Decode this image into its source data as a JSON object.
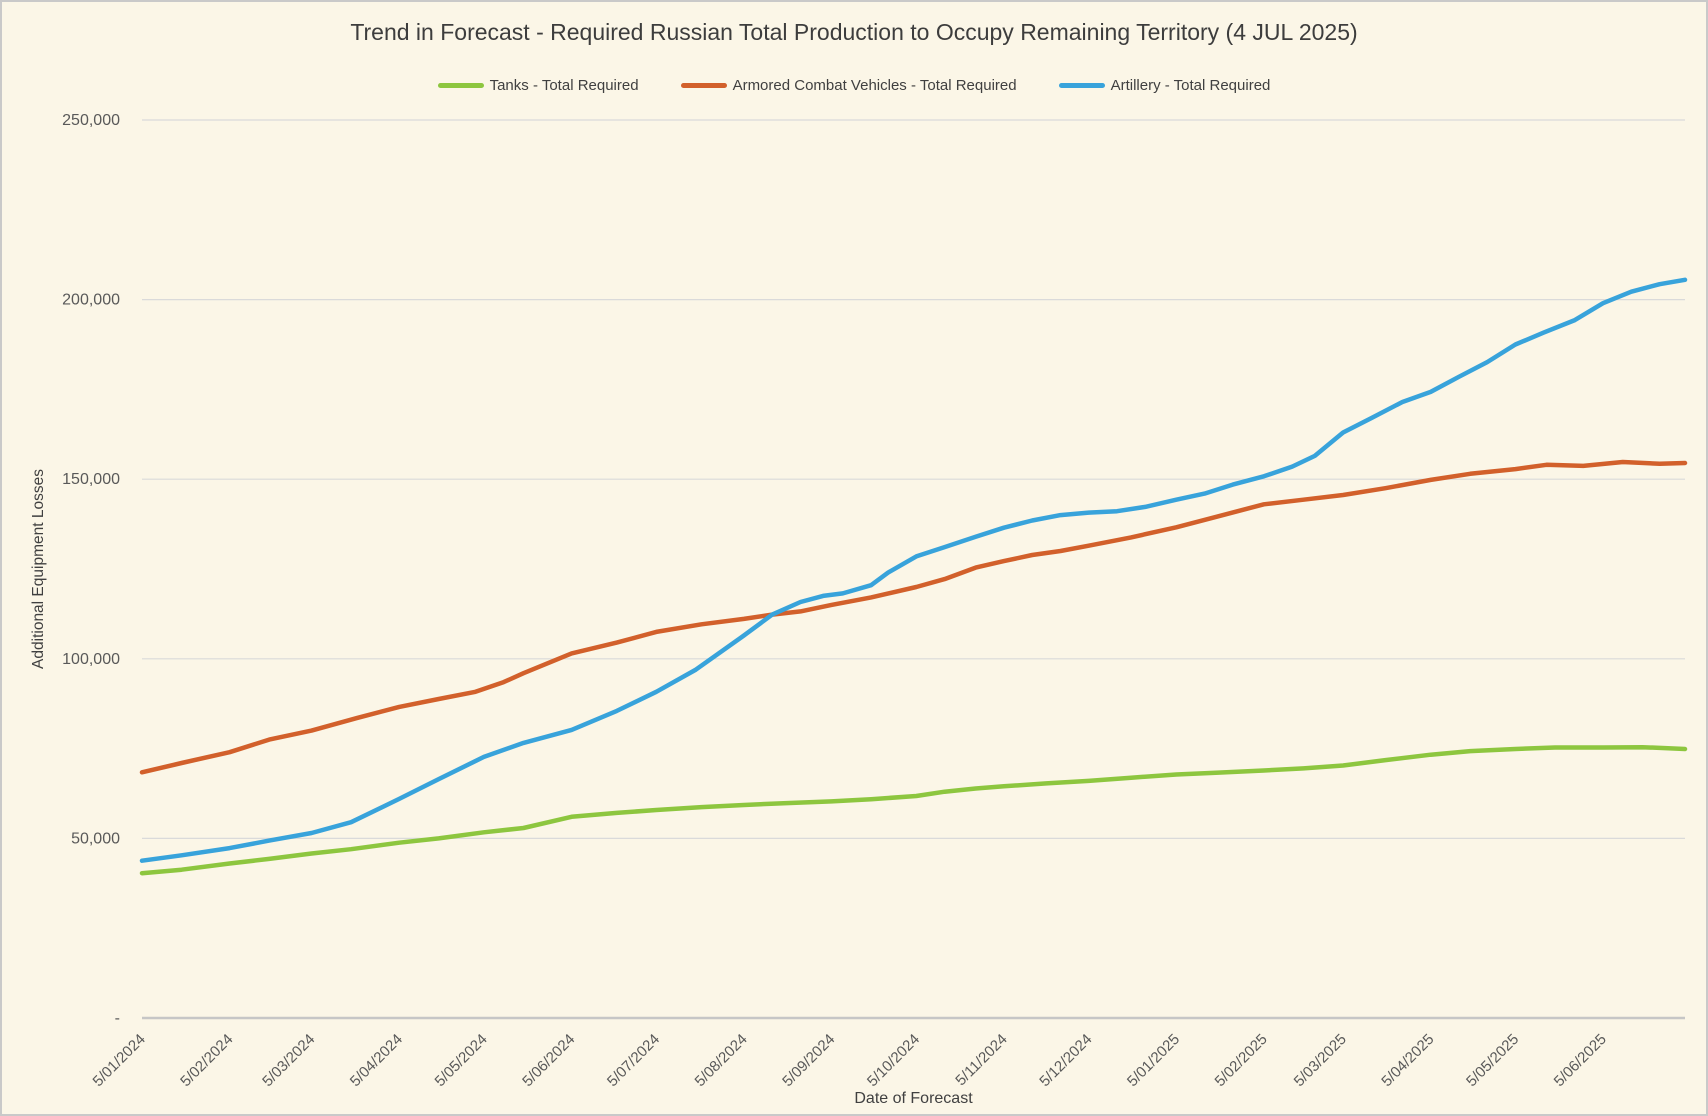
{
  "chart_data": {
    "type": "line",
    "title": "Trend in Forecast - Required Russian Total Production to Occupy Remaining Territory (4 JUL 2025)",
    "xlabel": "Date of Forecast",
    "ylabel": "Additional Equipment Losses",
    "legend_position": "top",
    "grid": "horizontal-only",
    "background_color": "#FBF6E7",
    "grid_color": "#DADADA",
    "axis_line_color": "#C6C6C6",
    "title_color": "#3D3D3D",
    "tick_label_color": "#595959",
    "ylim": [
      0,
      250000
    ],
    "x_axis_note": "weekly forecasts; day 0 = 5/01/2024, day 546 = 4 JUL 2025",
    "y_ticks": [
      {
        "value": 0,
        "label": "-"
      },
      {
        "value": 50000,
        "label": "50,000"
      },
      {
        "value": 100000,
        "label": "100,000"
      },
      {
        "value": 150000,
        "label": "150,000"
      },
      {
        "value": 200000,
        "label": "200,000"
      },
      {
        "value": 250000,
        "label": "250,000"
      }
    ],
    "x_ticks": [
      {
        "day": 0,
        "label": "5/01/2024"
      },
      {
        "day": 31,
        "label": "5/02/2024"
      },
      {
        "day": 60,
        "label": "5/03/2024"
      },
      {
        "day": 91,
        "label": "5/04/2024"
      },
      {
        "day": 121,
        "label": "5/05/2024"
      },
      {
        "day": 152,
        "label": "5/06/2024"
      },
      {
        "day": 182,
        "label": "5/07/2024"
      },
      {
        "day": 213,
        "label": "5/08/2024"
      },
      {
        "day": 244,
        "label": "5/09/2024"
      },
      {
        "day": 274,
        "label": "5/10/2024"
      },
      {
        "day": 305,
        "label": "5/11/2024"
      },
      {
        "day": 335,
        "label": "5/12/2024"
      },
      {
        "day": 366,
        "label": "5/01/2025"
      },
      {
        "day": 397,
        "label": "5/02/2025"
      },
      {
        "day": 425,
        "label": "5/03/2025"
      },
      {
        "day": 456,
        "label": "5/04/2025"
      },
      {
        "day": 486,
        "label": "5/05/2025"
      },
      {
        "day": 517,
        "label": "5/06/2025"
      }
    ],
    "series": [
      {
        "name": "Tanks - Total Required",
        "color": "#8DC63F",
        "points": [
          [
            0,
            40300
          ],
          [
            14,
            41300
          ],
          [
            31,
            43000
          ],
          [
            45,
            44300
          ],
          [
            60,
            45800
          ],
          [
            74,
            47000
          ],
          [
            91,
            48800
          ],
          [
            105,
            50000
          ],
          [
            121,
            51700
          ],
          [
            135,
            52900
          ],
          [
            152,
            56000
          ],
          [
            168,
            57100
          ],
          [
            182,
            57900
          ],
          [
            198,
            58700
          ],
          [
            213,
            59300
          ],
          [
            227,
            59800
          ],
          [
            244,
            60300
          ],
          [
            258,
            60900
          ],
          [
            274,
            61800
          ],
          [
            284,
            63000
          ],
          [
            295,
            63900
          ],
          [
            305,
            64500
          ],
          [
            320,
            65300
          ],
          [
            335,
            66000
          ],
          [
            350,
            66900
          ],
          [
            366,
            67800
          ],
          [
            380,
            68300
          ],
          [
            397,
            68900
          ],
          [
            411,
            69500
          ],
          [
            425,
            70300
          ],
          [
            440,
            71800
          ],
          [
            456,
            73300
          ],
          [
            470,
            74300
          ],
          [
            486,
            74900
          ],
          [
            500,
            75300
          ],
          [
            517,
            75300
          ],
          [
            531,
            75400
          ],
          [
            546,
            74900
          ]
        ]
      },
      {
        "name": "Armored Combat Vehicles - Total Required",
        "color": "#D2602B",
        "points": [
          [
            0,
            68400
          ],
          [
            14,
            71000
          ],
          [
            31,
            74000
          ],
          [
            45,
            77500
          ],
          [
            60,
            80000
          ],
          [
            76,
            83500
          ],
          [
            91,
            86600
          ],
          [
            105,
            88800
          ],
          [
            118,
            90800
          ],
          [
            128,
            93500
          ],
          [
            135,
            96000
          ],
          [
            152,
            101500
          ],
          [
            168,
            104500
          ],
          [
            182,
            107500
          ],
          [
            198,
            109600
          ],
          [
            213,
            111100
          ],
          [
            223,
            112300
          ],
          [
            233,
            113200
          ],
          [
            244,
            115000
          ],
          [
            258,
            117100
          ],
          [
            274,
            120000
          ],
          [
            284,
            122200
          ],
          [
            295,
            125400
          ],
          [
            305,
            127200
          ],
          [
            315,
            128900
          ],
          [
            325,
            130000
          ],
          [
            335,
            131500
          ],
          [
            350,
            133800
          ],
          [
            366,
            136600
          ],
          [
            380,
            139500
          ],
          [
            397,
            143000
          ],
          [
            411,
            144300
          ],
          [
            425,
            145600
          ],
          [
            440,
            147500
          ],
          [
            456,
            149800
          ],
          [
            470,
            151500
          ],
          [
            486,
            152800
          ],
          [
            497,
            154000
          ],
          [
            510,
            153700
          ],
          [
            524,
            154800
          ],
          [
            537,
            154300
          ],
          [
            546,
            154500
          ]
        ]
      },
      {
        "name": "Artillery - Total Required",
        "color": "#38A3DB",
        "points": [
          [
            0,
            43800
          ],
          [
            14,
            45300
          ],
          [
            31,
            47300
          ],
          [
            45,
            49400
          ],
          [
            60,
            51500
          ],
          [
            74,
            54500
          ],
          [
            91,
            61000
          ],
          [
            105,
            66500
          ],
          [
            121,
            72700
          ],
          [
            135,
            76600
          ],
          [
            152,
            80200
          ],
          [
            168,
            85500
          ],
          [
            182,
            90800
          ],
          [
            196,
            97000
          ],
          [
            213,
            106500
          ],
          [
            223,
            112300
          ],
          [
            233,
            115800
          ],
          [
            241,
            117500
          ],
          [
            248,
            118200
          ],
          [
            258,
            120500
          ],
          [
            264,
            124000
          ],
          [
            274,
            128500
          ],
          [
            284,
            131100
          ],
          [
            295,
            134000
          ],
          [
            305,
            136500
          ],
          [
            315,
            138500
          ],
          [
            325,
            140000
          ],
          [
            335,
            140700
          ],
          [
            345,
            141100
          ],
          [
            355,
            142300
          ],
          [
            366,
            144300
          ],
          [
            376,
            146000
          ],
          [
            386,
            148500
          ],
          [
            397,
            150800
          ],
          [
            407,
            153500
          ],
          [
            415,
            156500
          ],
          [
            425,
            163000
          ],
          [
            435,
            167000
          ],
          [
            446,
            171500
          ],
          [
            456,
            174300
          ],
          [
            466,
            178500
          ],
          [
            476,
            182600
          ],
          [
            486,
            187500
          ],
          [
            496,
            190800
          ],
          [
            507,
            194300
          ],
          [
            517,
            199000
          ],
          [
            527,
            202200
          ],
          [
            537,
            204300
          ],
          [
            546,
            205500
          ]
        ]
      }
    ]
  }
}
